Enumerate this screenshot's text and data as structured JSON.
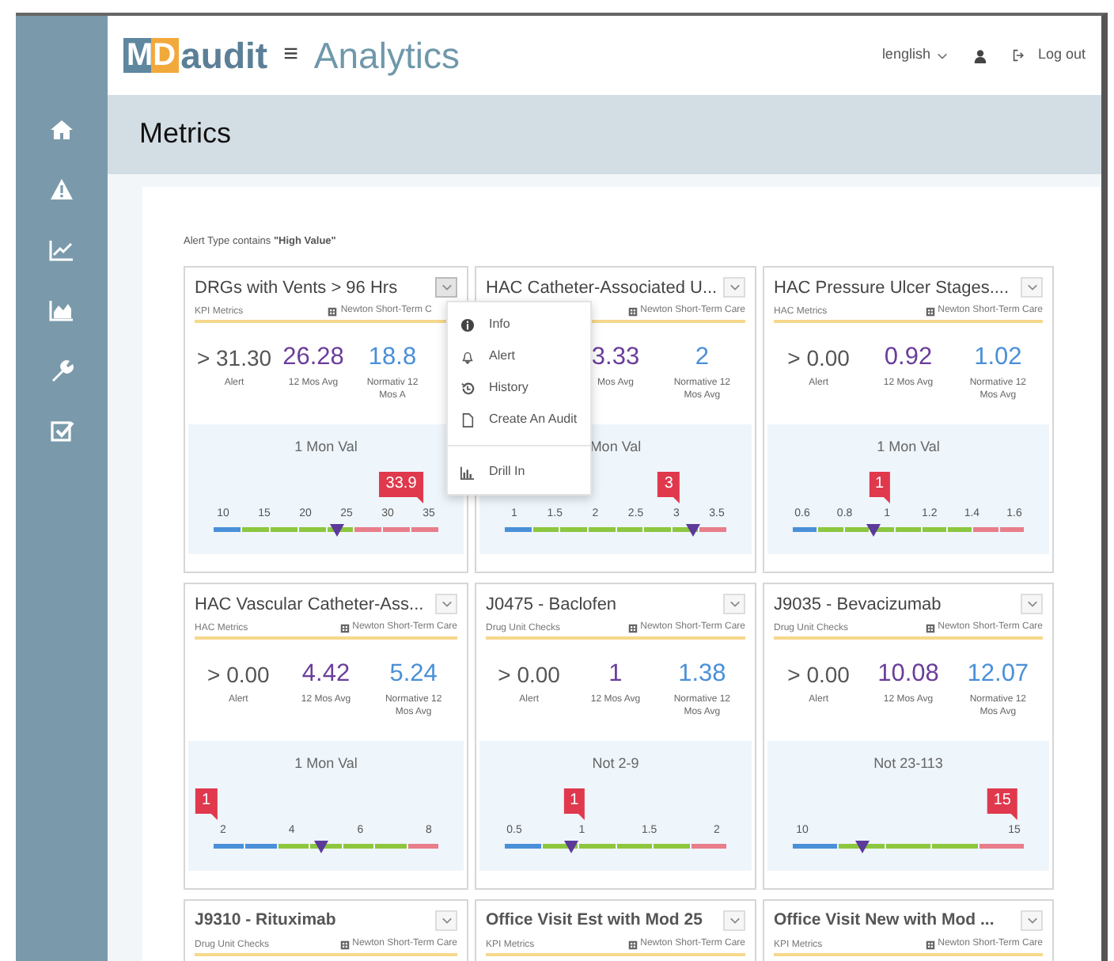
{
  "header": {
    "logo_boxed": "MD",
    "logo_text": "audit",
    "menu_glyph": "≡",
    "title": "Analytics",
    "language": "lenglish",
    "logout": "Log out"
  },
  "sidebar": {
    "items": [
      {
        "kind": "home"
      },
      {
        "kind": "alert"
      },
      {
        "kind": "line"
      },
      {
        "kind": "area"
      },
      {
        "kind": "wrench"
      },
      {
        "kind": "check"
      }
    ]
  },
  "page_title": "Metrics",
  "filter": "Alert Type contains **\"High Value\"**",
  "menu": {
    "items": [
      {
        "kind": "info",
        "label": "Info"
      },
      {
        "kind": "bell",
        "label": "Alert"
      },
      {
        "kind": "history",
        "label": "History"
      },
      {
        "kind": "doc",
        "label": "Create An Audit"
      },
      {
        "kind": "chart",
        "label": "Drill In",
        "divider": true
      }
    ]
  },
  "cards": [
    {
      "title": "DRGs with Vents > 96 Hrs",
      "category": "KPI Metrics",
      "location": "Newton Short-Term C",
      "menu_open": true,
      "stats": [
        {
          "kind": "alert",
          "value": "> 31.30",
          "label": "Alert"
        },
        {
          "kind": "avg",
          "value": "26.28",
          "label": "12 Mos Avg"
        },
        {
          "kind": "normative",
          "value": "18.8",
          "label": "Normativ 12 Mos A"
        }
      ],
      "gauge": {
        "title": "1 Mon Val",
        "flag": "33.9",
        "ticks": [
          "10",
          "15",
          "20",
          "25",
          "30",
          "35"
        ],
        "level": 0.55,
        "segments": [
          {
            "color": "#4a90d9"
          },
          {
            "color": "#8dc63f"
          },
          {
            "color": "#8dc63f"
          },
          {
            "color": "#8dc63f"
          },
          {
            "color": "#8dc63f"
          },
          {
            "color": "#e87e8a"
          },
          {
            "color": "#e87e8a"
          },
          {
            "color": "#e87e8a"
          }
        ]
      }
    },
    {
      "title": "HAC Catheter-Associated U...",
      "location": "Newton Short-Term Care",
      "menu_open": false,
      "stats": [
        {
          "kind": "alert"
        },
        {
          "kind": "avg",
          "value": "3.33",
          "label": "Mos Avg"
        },
        {
          "kind": "normative",
          "value": "2",
          "label": "Normative 12 Mos Avg"
        }
      ],
      "gauge": {
        "title": "Mon Val",
        "flag": "3",
        "ticks": [
          "1",
          "1.5",
          "2",
          "2.5",
          "3",
          "3.5"
        ],
        "level": 0.85,
        "segments": [
          {
            "color": "#4a90d9"
          },
          {
            "color": "#8dc63f"
          },
          {
            "color": "#8dc63f"
          },
          {
            "color": "#8dc63f"
          },
          {
            "color": "#8dc63f"
          },
          {
            "color": "#8dc63f"
          },
          {
            "color": "#8dc63f"
          },
          {
            "color": "#e87e8a"
          }
        ]
      }
    },
    {
      "title": "HAC Pressure Ulcer Stages....",
      "category": "HAC Metrics",
      "location": "Newton Short-Term Care",
      "menu_open": false,
      "stats": [
        {
          "kind": "alert",
          "value": "> 0.00",
          "label": "Alert"
        },
        {
          "kind": "avg",
          "value": "0.92",
          "label": "12 Mos Avg"
        },
        {
          "kind": "normative",
          "value": "1.02",
          "label": "Normative 12 Mos Avg"
        }
      ],
      "gauge": {
        "title": "1 Mon Val",
        "flag": "1",
        "ticks": [
          "0.6",
          "0.8",
          "1",
          "1.2",
          "1.4",
          "1.6"
        ],
        "level": 0.35,
        "segments": [
          {
            "color": "#4a90d9"
          },
          {
            "color": "#8dc63f"
          },
          {
            "color": "#8dc63f"
          },
          {
            "color": "#8dc63f"
          },
          {
            "color": "#8dc63f"
          },
          {
            "color": "#8dc63f"
          },
          {
            "color": "#8dc63f"
          },
          {
            "color": "#e87e8a"
          },
          {
            "color": "#e87e8a"
          }
        ]
      }
    },
    {
      "title": "HAC Vascular Catheter-Ass...",
      "category": "HAC Metrics",
      "location": "Newton Short-Term Care",
      "menu_open": false,
      "stats": [
        {
          "kind": "alert",
          "value": "> 0.00",
          "label": "Alert"
        },
        {
          "kind": "avg",
          "value": "4.42",
          "label": "12 Mos Avg"
        },
        {
          "kind": "normative",
          "value": "5.24",
          "label": "Normative 12 Mos Avg"
        }
      ],
      "gauge": {
        "title": "1 Mon Val",
        "flag": "1",
        "ticks": [
          "2",
          "4",
          "6",
          "8"
        ],
        "level": 0.48,
        "segments": [
          {
            "color": "#4a90d9"
          },
          {
            "color": "#4a90d9"
          },
          {
            "color": "#8dc63f"
          },
          {
            "color": "#8dc63f"
          },
          {
            "color": "#8dc63f"
          },
          {
            "color": "#8dc63f"
          },
          {
            "color": "#e87e8a"
          }
        ]
      }
    },
    {
      "title": "J0475 - Baclofen",
      "category": "Drug Unit Checks",
      "location": "Newton Short-Term Care",
      "menu_open": false,
      "stats": [
        {
          "kind": "alert",
          "value": "> 0.00",
          "label": "Alert"
        },
        {
          "kind": "avg",
          "value": "1",
          "label": "12 Mos Avg"
        },
        {
          "kind": "normative",
          "value": "1.38",
          "label": "Normative 12 Mos Avg"
        }
      ],
      "gauge": {
        "title": "Not 2-9",
        "flag": "1",
        "ticks": [
          "0.5",
          "1",
          "1.5",
          "2"
        ],
        "level": 0.3,
        "segments": [
          {
            "color": "#4a90d9"
          },
          {
            "color": "#8dc63f"
          },
          {
            "color": "#8dc63f"
          },
          {
            "color": "#8dc63f"
          },
          {
            "color": "#8dc63f"
          },
          {
            "color": "#e87e8a"
          }
        ]
      }
    },
    {
      "title": "J9035 - Bevacizumab",
      "category": "Drug Unit Checks",
      "location": "Newton Short-Term Care",
      "menu_open": false,
      "stats": [
        {
          "kind": "alert",
          "value": "> 0.00",
          "label": "Alert"
        },
        {
          "kind": "avg",
          "value": "10.08",
          "label": "12 Mos Avg"
        },
        {
          "kind": "normative",
          "value": "12.07",
          "label": "Normative 12 Mos Avg"
        }
      ],
      "gauge": {
        "title": "Not 23-113",
        "flag": "15",
        "ticks": [
          "10",
          "15"
        ],
        "level": 0.3,
        "segments": [
          {
            "color": "#4a90d9"
          },
          {
            "color": "#8dc63f"
          },
          {
            "color": "#8dc63f"
          },
          {
            "color": "#8dc63f"
          },
          {
            "color": "#e87e8a"
          }
        ]
      }
    },
    {
      "title": "J9310 - Rituximab",
      "category": "Drug Unit Checks",
      "location": "Newton Short-Term Care",
      "menu_open": false,
      "bold_title": true
    },
    {
      "title": "Office Visit Est with Mod 25",
      "category": "KPI Metrics",
      "location": "Newton Short-Term Care",
      "menu_open": false,
      "bold_title": true
    },
    {
      "title": "Office Visit New with Mod ...",
      "category": "KPI Metrics",
      "location": "Newton Short-Term Care",
      "menu_open": false,
      "bold_title": true
    }
  ]
}
